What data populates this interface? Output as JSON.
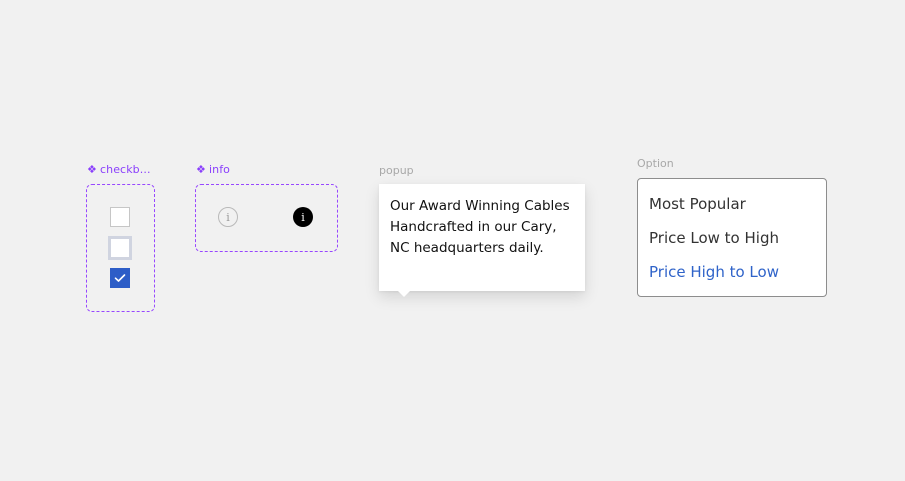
{
  "checkbox_set": {
    "label": "checkb...",
    "icon": "component-icon",
    "accent_color": "#9747ff",
    "checked_color": "#2d5dc7",
    "states": [
      "default",
      "focus",
      "checked"
    ]
  },
  "info_set": {
    "label": "info",
    "icon": "component-icon",
    "glyph": "i"
  },
  "popup": {
    "label": "popup",
    "text": "Our Award Winning Cables Handcrafted in our Cary, NC headquarters daily."
  },
  "option": {
    "label": "Option",
    "selected_color": "#2f63c9",
    "items": [
      {
        "label": "Most Popular",
        "selected": false
      },
      {
        "label": "Price Low to High",
        "selected": false
      },
      {
        "label": "Price High to Low",
        "selected": true
      }
    ]
  }
}
